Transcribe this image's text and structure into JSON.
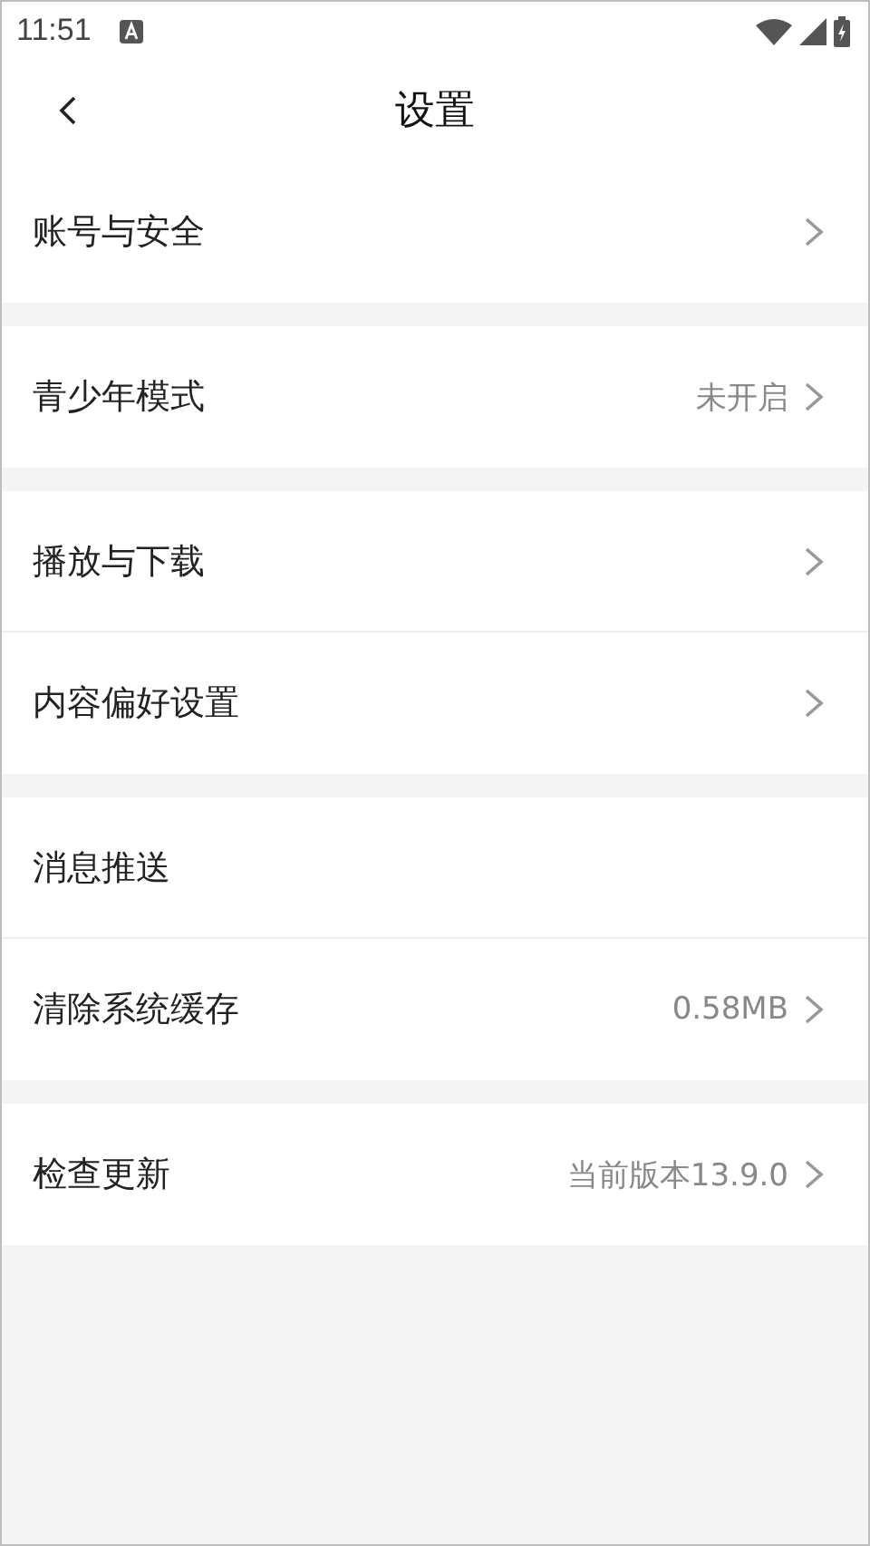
{
  "status_bar": {
    "time": "11:51"
  },
  "header": {
    "title": "设置"
  },
  "groups": [
    {
      "items": [
        {
          "label": "账号与安全",
          "kind": "nav"
        }
      ]
    },
    {
      "items": [
        {
          "label": "青少年模式",
          "value": "未开启",
          "kind": "nav"
        }
      ]
    },
    {
      "items": [
        {
          "label": "播放与下载",
          "kind": "nav"
        },
        {
          "label": "内容偏好设置",
          "kind": "nav"
        }
      ]
    },
    {
      "items": [
        {
          "label": "消息推送",
          "kind": "plain"
        },
        {
          "label": "清除系统缓存",
          "value": "0.58MB",
          "kind": "nav"
        }
      ]
    },
    {
      "items": [
        {
          "label": "检查更新",
          "value": "当前版本13.9.0",
          "kind": "nav"
        }
      ]
    }
  ]
}
